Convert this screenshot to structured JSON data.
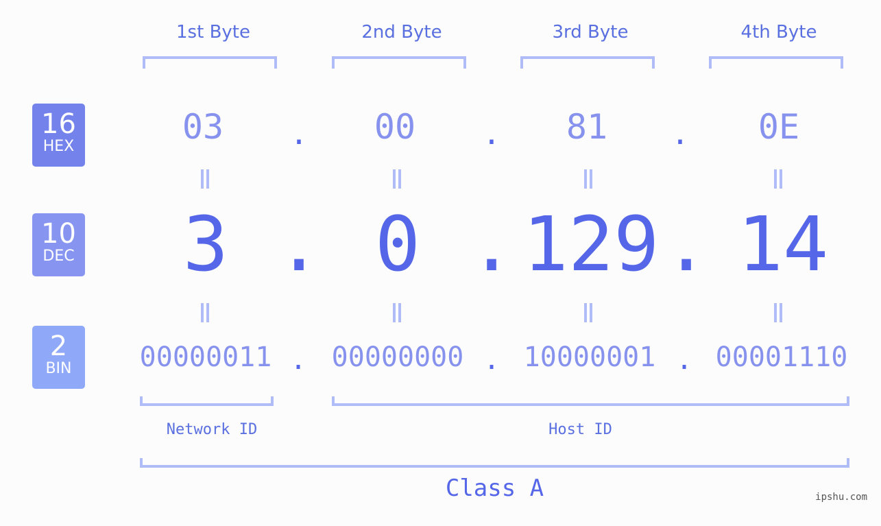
{
  "bytes": [
    {
      "label": "1st Byte",
      "hex": "03",
      "dec": "3",
      "bin": "00000011"
    },
    {
      "label": "2nd Byte",
      "hex": "00",
      "dec": "0",
      "bin": "00000000"
    },
    {
      "label": "3rd Byte",
      "hex": "81",
      "dec": "129",
      "bin": "10000001"
    },
    {
      "label": "4th Byte",
      "hex": "0E",
      "dec": "14",
      "bin": "00001110"
    }
  ],
  "separator": ".",
  "rows": {
    "hex": {
      "base": "16",
      "label": "HEX",
      "color": "#7482ec"
    },
    "dec": {
      "base": "10",
      "label": "DEC",
      "color": "#8795f1"
    },
    "bin": {
      "base": "2",
      "label": "BIN",
      "color": "#90a8f8"
    }
  },
  "network_id_label": "Network ID",
  "host_id_label": "Host ID",
  "class_label": "Class A",
  "watermark": "ipshu.com"
}
